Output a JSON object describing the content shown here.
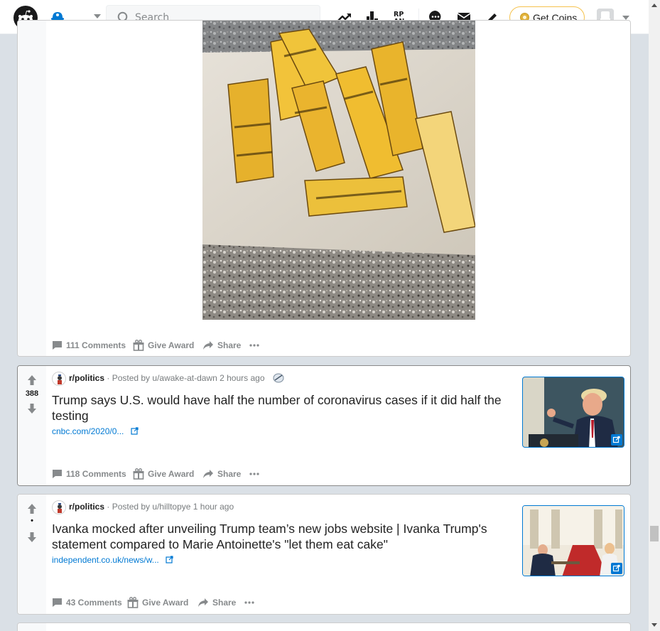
{
  "header": {
    "search_placeholder": "Search",
    "get_coins_label": "Get Coins"
  },
  "posts": [
    {
      "comments_label": "111 Comments",
      "award_label": "Give Award",
      "share_label": "Share"
    },
    {
      "score": "388",
      "subreddit": "r/politics",
      "posted_by": "· Posted by u/awake-at-dawn 2 hours ago",
      "title": "Trump says U.S. would have half the number of coronavirus cases if it did half the testing",
      "link": "cnbc.com/2020/0...",
      "comments_label": "118 Comments",
      "award_label": "Give Award",
      "share_label": "Share"
    },
    {
      "score": "•",
      "subreddit": "r/politics",
      "posted_by": "· Posted by u/hilltopye 1 hour ago",
      "title": "Ivanka mocked after unveiling Trump team’s new jobs website | Ivanka Trump's statement compared to Marie Antoinette's \"let them eat cake\"",
      "link": "independent.co.uk/news/w...",
      "comments_label": "43 Comments",
      "award_label": "Give Award",
      "share_label": "Share"
    }
  ],
  "colors": {
    "accent": "#0079d3",
    "coin_border": "#f5c24d"
  }
}
